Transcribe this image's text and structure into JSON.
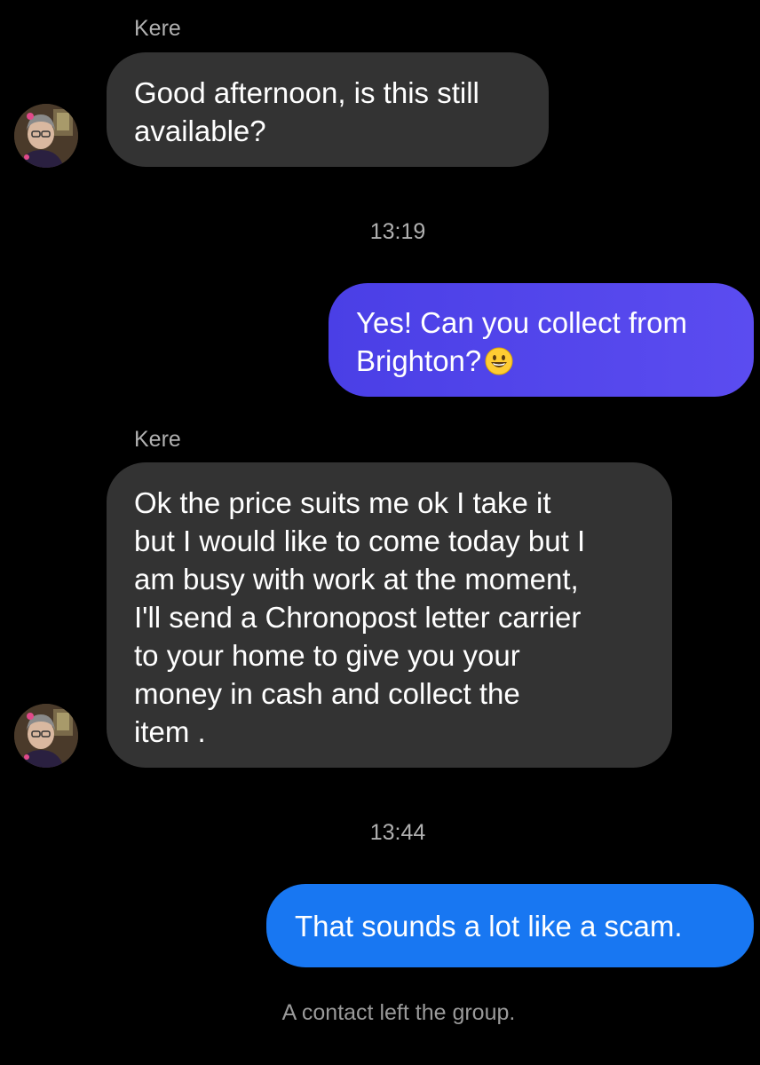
{
  "messages": [
    {
      "type": "incoming",
      "sender": "Kere",
      "text": "Good afternoon, is this still\navailable?"
    },
    {
      "type": "timestamp",
      "text": "13:19"
    },
    {
      "type": "outgoing",
      "text": "Yes! Can you collect from\nBrighton?",
      "emoji": "grinning-face-emoji"
    },
    {
      "type": "incoming",
      "sender": "Kere",
      "text": "Ok the price suits me ok I take it\nbut I would like to come today but I\nam busy with work at the moment,\nI'll send a Chronopost letter carrier\nto your home to give you your\nmoney in cash and collect the\nitem ."
    },
    {
      "type": "timestamp",
      "text": "13:44"
    },
    {
      "type": "outgoing",
      "text": "That sounds a lot like a scam."
    },
    {
      "type": "system",
      "text": "A contact left the group."
    }
  ],
  "colors": {
    "background": "#000000",
    "incoming_bubble": "#333333",
    "outgoing_bubble_purple": "#5044ea",
    "outgoing_bubble_blue": "#1877f2",
    "meta_text": "#b0b0b0"
  }
}
